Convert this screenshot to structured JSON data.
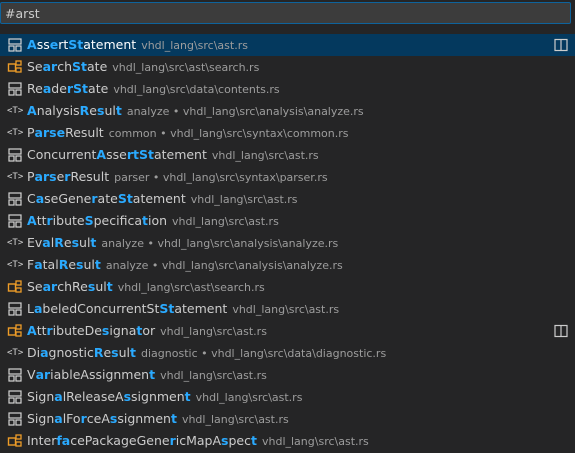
{
  "search": {
    "value": "#arst",
    "placeholder": ""
  },
  "colors": {
    "struct_icon": "#d4d4d4",
    "class_icon": "#ee9d28",
    "highlight": "#2aaaff",
    "selected_bg": "#04395e",
    "input_border": "#0e639c"
  },
  "results": [
    {
      "icon": "struct-icon",
      "segments": [
        {
          "t": "A",
          "h": true
        },
        {
          "t": "ss",
          "h": false
        },
        {
          "t": "e",
          "h": true
        },
        {
          "t": "rt",
          "h": false
        },
        {
          "t": "St",
          "h": true
        },
        {
          "t": "atement",
          "h": false
        }
      ],
      "description": "vhdl_lang\\src\\ast.rs",
      "selected": true,
      "split": true
    },
    {
      "icon": "class-icon",
      "segments": [
        {
          "t": "Se",
          "h": false
        },
        {
          "t": "ar",
          "h": true
        },
        {
          "t": "ch",
          "h": false
        },
        {
          "t": "St",
          "h": true
        },
        {
          "t": "ate",
          "h": false
        }
      ],
      "description": "vhdl_lang\\src\\ast\\search.rs",
      "selected": false,
      "split": false
    },
    {
      "icon": "struct-icon",
      "segments": [
        {
          "t": "Re",
          "h": false
        },
        {
          "t": "a",
          "h": true
        },
        {
          "t": "de",
          "h": false
        },
        {
          "t": "rSt",
          "h": true
        },
        {
          "t": "ate",
          "h": false
        }
      ],
      "description": "vhdl_lang\\src\\data\\contents.rs",
      "selected": false,
      "split": false
    },
    {
      "icon": "type-param-icon",
      "segments": [
        {
          "t": "A",
          "h": true
        },
        {
          "t": "nalysis",
          "h": false
        },
        {
          "t": "R",
          "h": true
        },
        {
          "t": "e",
          "h": false
        },
        {
          "t": "s",
          "h": true
        },
        {
          "t": "ul",
          "h": false
        },
        {
          "t": "t",
          "h": true
        }
      ],
      "description": "analyze • vhdl_lang\\src\\analysis\\analyze.rs",
      "selected": false,
      "split": false
    },
    {
      "icon": "type-param-icon",
      "segments": [
        {
          "t": "P",
          "h": false
        },
        {
          "t": "arse",
          "h": true
        },
        {
          "t": "Result",
          "h": false
        }
      ],
      "description": "common • vhdl_lang\\src\\syntax\\common.rs",
      "selected": false,
      "split": false
    },
    {
      "icon": "struct-icon",
      "segments": [
        {
          "t": "Concurrent",
          "h": false
        },
        {
          "t": "A",
          "h": true
        },
        {
          "t": "sse",
          "h": false
        },
        {
          "t": "rtSt",
          "h": true
        },
        {
          "t": "atement",
          "h": false
        }
      ],
      "description": "vhdl_lang\\src\\ast.rs",
      "selected": false,
      "split": false
    },
    {
      "icon": "type-param-icon",
      "segments": [
        {
          "t": "P",
          "h": false
        },
        {
          "t": "ars",
          "h": true
        },
        {
          "t": "e",
          "h": false
        },
        {
          "t": "r",
          "h": true
        },
        {
          "t": "Result",
          "h": false
        }
      ],
      "description": "parser • vhdl_lang\\src\\syntax\\parser.rs",
      "selected": false,
      "split": false
    },
    {
      "icon": "struct-icon",
      "segments": [
        {
          "t": "C",
          "h": false
        },
        {
          "t": "a",
          "h": true
        },
        {
          "t": "seGene",
          "h": false
        },
        {
          "t": "r",
          "h": true
        },
        {
          "t": "ate",
          "h": false
        },
        {
          "t": "St",
          "h": true
        },
        {
          "t": "atement",
          "h": false
        }
      ],
      "description": "vhdl_lang\\src\\ast.rs",
      "selected": false,
      "split": false
    },
    {
      "icon": "struct-icon",
      "segments": [
        {
          "t": "A",
          "h": true
        },
        {
          "t": "tt",
          "h": false
        },
        {
          "t": "r",
          "h": true
        },
        {
          "t": "ibute",
          "h": false
        },
        {
          "t": "S",
          "h": true
        },
        {
          "t": "pecifica",
          "h": false
        },
        {
          "t": "t",
          "h": true
        },
        {
          "t": "ion",
          "h": false
        }
      ],
      "description": "vhdl_lang\\src\\ast.rs",
      "selected": false,
      "split": false
    },
    {
      "icon": "type-param-icon",
      "segments": [
        {
          "t": "Ev",
          "h": false
        },
        {
          "t": "a",
          "h": true
        },
        {
          "t": "l",
          "h": false
        },
        {
          "t": "R",
          "h": true
        },
        {
          "t": "e",
          "h": false
        },
        {
          "t": "s",
          "h": true
        },
        {
          "t": "ul",
          "h": false
        },
        {
          "t": "t",
          "h": true
        }
      ],
      "description": "analyze • vhdl_lang\\src\\analysis\\analyze.rs",
      "selected": false,
      "split": false
    },
    {
      "icon": "type-param-icon",
      "segments": [
        {
          "t": "F",
          "h": false
        },
        {
          "t": "a",
          "h": true
        },
        {
          "t": "tal",
          "h": false
        },
        {
          "t": "R",
          "h": true
        },
        {
          "t": "e",
          "h": false
        },
        {
          "t": "s",
          "h": true
        },
        {
          "t": "ul",
          "h": false
        },
        {
          "t": "t",
          "h": true
        }
      ],
      "description": "analyze • vhdl_lang\\src\\analysis\\analyze.rs",
      "selected": false,
      "split": false
    },
    {
      "icon": "class-icon",
      "segments": [
        {
          "t": "Se",
          "h": false
        },
        {
          "t": "ar",
          "h": true
        },
        {
          "t": "ch",
          "h": false
        },
        {
          "t": "R",
          "h": false
        },
        {
          "t": "e",
          "h": false
        },
        {
          "t": "s",
          "h": true
        },
        {
          "t": "ul",
          "h": false
        },
        {
          "t": "t",
          "h": true
        }
      ],
      "description": "vhdl_lang\\src\\ast\\search.rs",
      "selected": false,
      "split": false
    },
    {
      "icon": "struct-icon",
      "segments": [
        {
          "t": "L",
          "h": false
        },
        {
          "t": "a",
          "h": true
        },
        {
          "t": "beledCon",
          "h": false
        },
        {
          "t": "curr",
          "h": false
        },
        {
          "t": "entSt",
          "h": false
        },
        {
          "t": "St",
          "h": true
        },
        {
          "t": "atement",
          "h": false
        }
      ],
      "description": "vhdl_lang\\src\\ast.rs",
      "selected": false,
      "split": false
    },
    {
      "icon": "class-icon",
      "segments": [
        {
          "t": "A",
          "h": true
        },
        {
          "t": "tt",
          "h": false
        },
        {
          "t": "r",
          "h": true
        },
        {
          "t": "ibuteDe",
          "h": false
        },
        {
          "t": "s",
          "h": true
        },
        {
          "t": "igna",
          "h": false
        },
        {
          "t": "t",
          "h": true
        },
        {
          "t": "or",
          "h": false
        }
      ],
      "description": "vhdl_lang\\src\\ast.rs",
      "selected": false,
      "split": true
    },
    {
      "icon": "type-param-icon",
      "segments": [
        {
          "t": "Di",
          "h": false
        },
        {
          "t": "a",
          "h": true
        },
        {
          "t": "gnostic",
          "h": false
        },
        {
          "t": "R",
          "h": true
        },
        {
          "t": "e",
          "h": false
        },
        {
          "t": "s",
          "h": true
        },
        {
          "t": "ul",
          "h": false
        },
        {
          "t": "t",
          "h": true
        }
      ],
      "description": "diagnostic • vhdl_lang\\src\\data\\diagnostic.rs",
      "selected": false,
      "split": false
    },
    {
      "icon": "struct-icon",
      "segments": [
        {
          "t": "V",
          "h": false
        },
        {
          "t": "ar",
          "h": true
        },
        {
          "t": "iableAssignmen",
          "h": false
        },
        {
          "t": "t",
          "h": true
        }
      ],
      "description": "vhdl_lang\\src\\ast.rs",
      "selected": false,
      "split": false
    },
    {
      "icon": "struct-icon",
      "segments": [
        {
          "t": "Sign",
          "h": false
        },
        {
          "t": "a",
          "h": true
        },
        {
          "t": "lReleaseA",
          "h": false
        },
        {
          "t": "s",
          "h": true
        },
        {
          "t": "signmen",
          "h": false
        },
        {
          "t": "t",
          "h": true
        }
      ],
      "description": "vhdl_lang\\src\\ast.rs",
      "selected": false,
      "split": false
    },
    {
      "icon": "struct-icon",
      "segments": [
        {
          "t": "Sign",
          "h": false
        },
        {
          "t": "a",
          "h": true
        },
        {
          "t": "lFo",
          "h": false
        },
        {
          "t": "r",
          "h": true
        },
        {
          "t": "ceA",
          "h": false
        },
        {
          "t": "s",
          "h": true
        },
        {
          "t": "signmen",
          "h": false
        },
        {
          "t": "t",
          "h": true
        }
      ],
      "description": "vhdl_lang\\src\\ast.rs",
      "selected": false,
      "split": false
    },
    {
      "icon": "class-icon",
      "segments": [
        {
          "t": "Inter",
          "h": false
        },
        {
          "t": "fa",
          "h": true
        },
        {
          "t": "cePackageGene",
          "h": false
        },
        {
          "t": "r",
          "h": true
        },
        {
          "t": "icMapA",
          "h": false
        },
        {
          "t": "s",
          "h": true
        },
        {
          "t": "pec",
          "h": false
        },
        {
          "t": "t",
          "h": true
        }
      ],
      "description": "vhdl_lang\\src\\ast.rs",
      "selected": false,
      "split": false
    }
  ]
}
